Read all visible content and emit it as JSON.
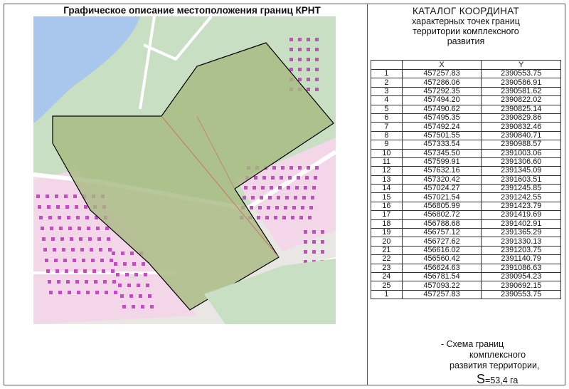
{
  "map": {
    "title": "Графическое описание местоположения границ КРНТ"
  },
  "catalog": {
    "title_line1": "КАТАЛОГ КООРДИНАТ",
    "title_line2": "характерных точек границ",
    "title_line3": "территории комплексного",
    "title_line4": "развития",
    "col_x": "X",
    "col_y": "Y",
    "rows": [
      [
        "1",
        "457257.83",
        "2390553.75"
      ],
      [
        "2",
        "457286.06",
        "2390586.91"
      ],
      [
        "3",
        "457292.35",
        "2390581.62"
      ],
      [
        "4",
        "457494.20",
        "2390822.02"
      ],
      [
        "5",
        "457490.62",
        "2390825.14"
      ],
      [
        "6",
        "457495.35",
        "2390829.86"
      ],
      [
        "7",
        "457492.24",
        "2390832.46"
      ],
      [
        "8",
        "457501.55",
        "2390840.71"
      ],
      [
        "9",
        "457333.54",
        "2390988.57"
      ],
      [
        "10",
        "457345.50",
        "2391003.06"
      ],
      [
        "11",
        "457599.91",
        "2391306.60"
      ],
      [
        "12",
        "457632.16",
        "2391345.09"
      ],
      [
        "13",
        "457320.42",
        "2391603.51"
      ],
      [
        "14",
        "457024.27",
        "2391245.85"
      ],
      [
        "15",
        "457021.54",
        "2391242.55"
      ],
      [
        "16",
        "456805.99",
        "2391423.79"
      ],
      [
        "17",
        "456802.72",
        "2391419.69"
      ],
      [
        "18",
        "456788.68",
        "2391402.91"
      ],
      [
        "19",
        "456757.12",
        "2391365.29"
      ],
      [
        "20",
        "456727.62",
        "2391330.13"
      ],
      [
        "21",
        "456616.02",
        "2391203.75"
      ],
      [
        "22",
        "456560.42",
        "2391140.79"
      ],
      [
        "23",
        "456624.63",
        "2391086.63"
      ],
      [
        "24",
        "456781.54",
        "2390954.23"
      ],
      [
        "25",
        "457093.22",
        "2390692.15"
      ],
      [
        "1",
        "457257.83",
        "2390553.75"
      ]
    ]
  },
  "caption": {
    "line1": "- Схема границ",
    "line2": "комплексного",
    "line3": "развития территории,",
    "s_symbol": "S",
    "area": "=53,4 га"
  },
  "colors": {
    "water": "#a9c6ec",
    "green": "#c8dfc4",
    "land": "#e9e7e3",
    "parcel": "#a6b97f",
    "building": "#c44bc1",
    "block": "#f3d6e8",
    "road": "#ffffff",
    "boundary": "#000000"
  }
}
